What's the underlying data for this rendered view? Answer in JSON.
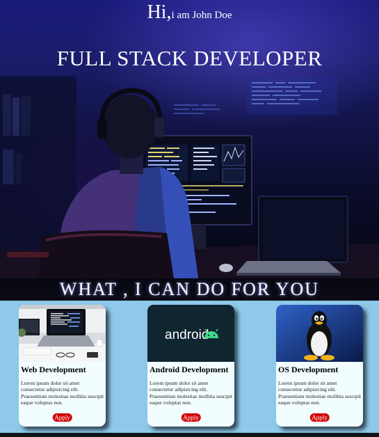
{
  "hero": {
    "greeting_hi": "Hi,",
    "greeting_name": "i am John Doe",
    "title": "FULL STACK DEVELOPER"
  },
  "section": {
    "title": "WHAT , I CAN DO FOR YOU"
  },
  "cards": [
    {
      "title": "Web Development",
      "text": "Lorem ipsum dolor sit amet consectetur adipisicing elit. Praesentium molestiae mollitia suscipit eaque voluptas non.",
      "button": "Apply",
      "image": "laptop-desk-photo"
    },
    {
      "title": "Android Development",
      "text": "Lorem ipsum dolor sit amet consectetur adipisicing elit. Praesentium molestiae mollitia suscipit eaque voluptas non.",
      "button": "Apply",
      "image": "android-logo",
      "logo_text": "android"
    },
    {
      "title": "OS Development",
      "text": "Lorem ipsum dolor sit amet consectetur adipisicing elit. Praesentium molestiae mollitia suscipit eaque voluptas non.",
      "button": "Apply",
      "image": "linux-tux-penguin"
    }
  ],
  "colors": {
    "page_background": "#8ec9ea",
    "card_background": "#f2fdff",
    "apply_button": "#d40000",
    "android_green": "#3ddc84",
    "hero_blue": "#1b1c6b"
  }
}
